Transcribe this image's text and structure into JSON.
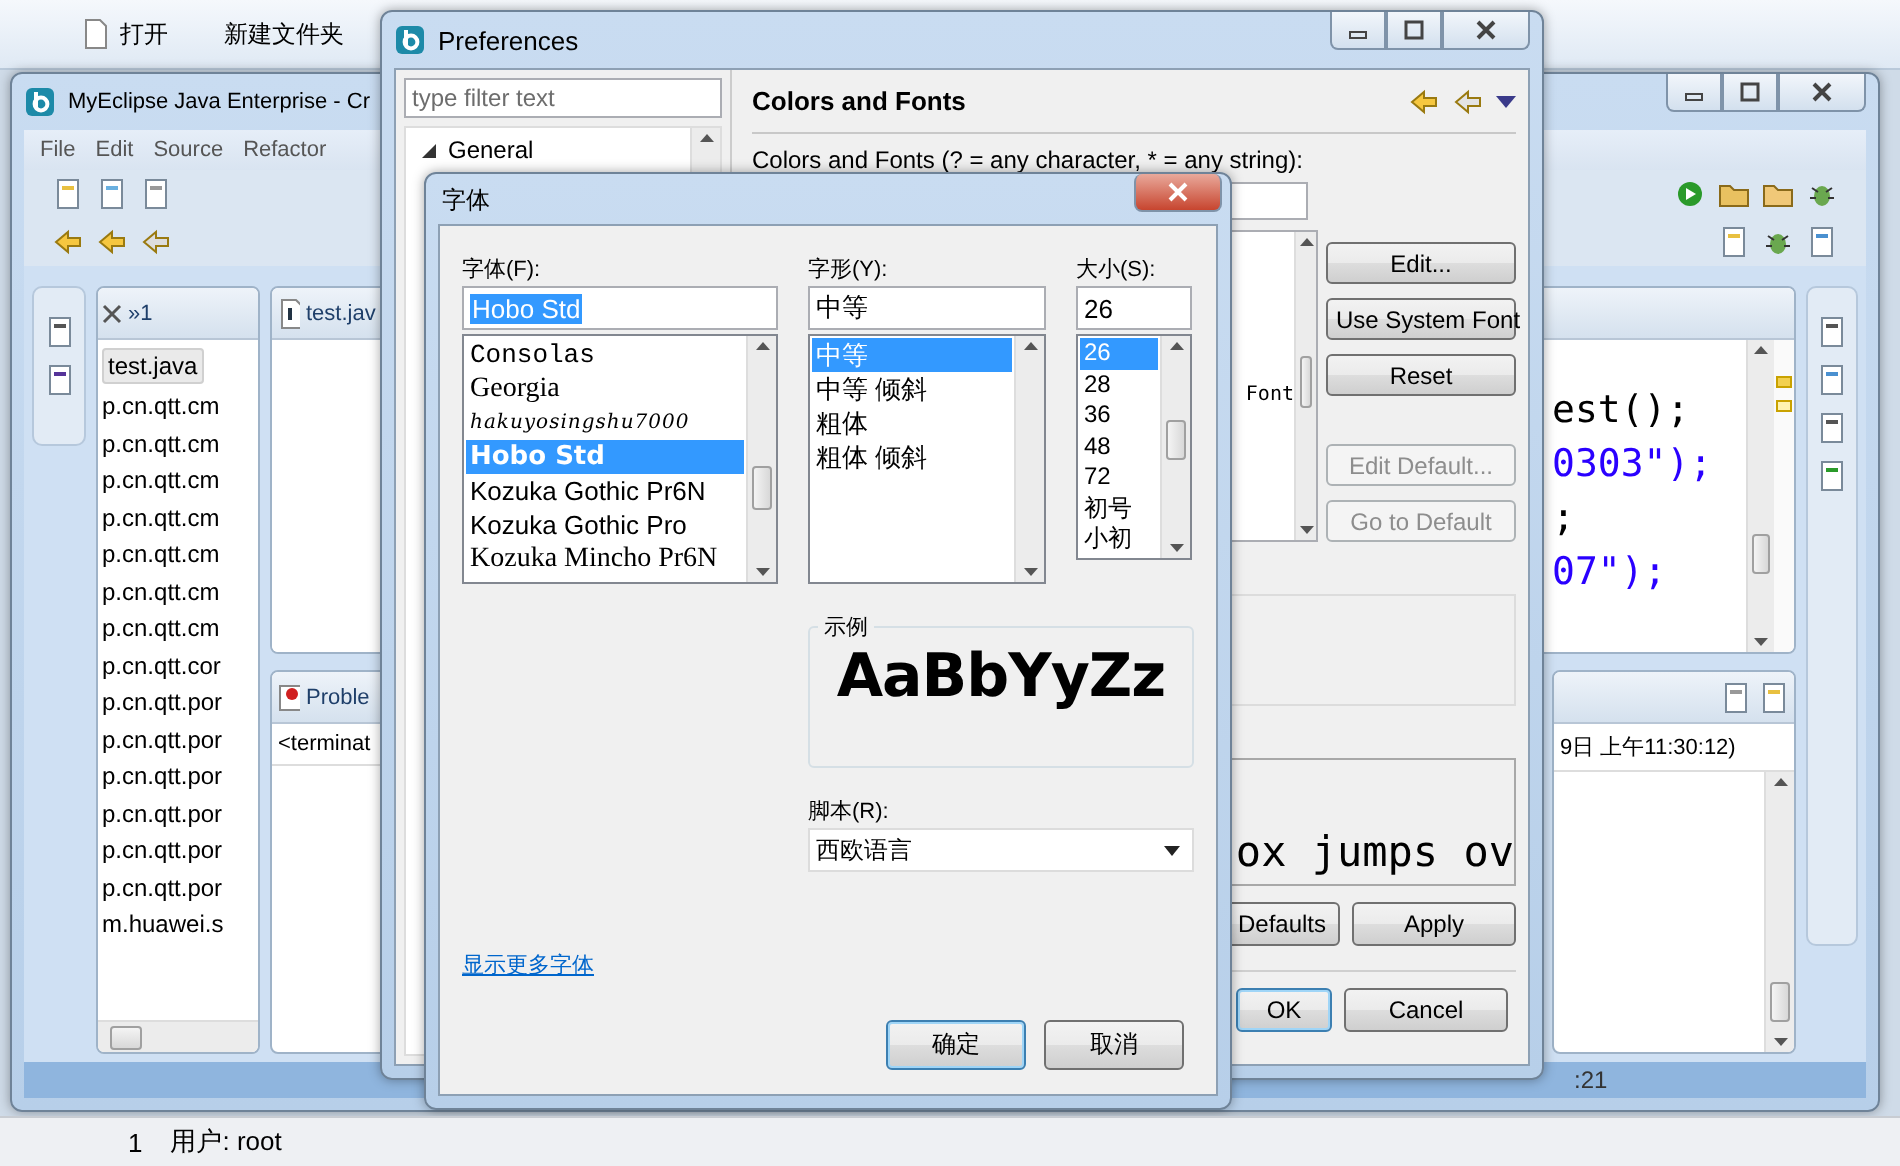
{
  "desktop": {
    "toolbar": [
      "打开",
      "新建文件夹"
    ],
    "status": [
      "1",
      "用户: root"
    ]
  },
  "ide": {
    "title": "MyEclipse Java Enterprise - Cr",
    "menu": [
      "File",
      "Edit",
      "Source",
      "Refactor"
    ],
    "explorer": {
      "tab": "»1",
      "file_tab": "test.java",
      "items": [
        "p.cn.qtt.cm",
        "p.cn.qtt.cm",
        "p.cn.qtt.cm",
        "p.cn.qtt.cm",
        "p.cn.qtt.cm",
        "p.cn.qtt.cm",
        "p.cn.qtt.cm",
        "p.cn.qtt.cor",
        "p.cn.qtt.por",
        "p.cn.qtt.por",
        "p.cn.qtt.por",
        "p.cn.qtt.por",
        "p.cn.qtt.por",
        "p.cn.qtt.por",
        "m.huawei.s"
      ]
    },
    "editor": {
      "tab": "test.jav",
      "code": [
        {
          "text": "est();",
          "kind": "plain"
        },
        {
          "text": "0303\");",
          "kind": "string"
        },
        {
          "text": ";",
          "kind": "plain"
        },
        {
          "text": "07\");",
          "kind": "string"
        }
      ]
    },
    "problems": {
      "tab": "Proble",
      "text": "<terminat"
    },
    "console": {
      "text": "9日 上午11:30:12)"
    },
    "status": ":21"
  },
  "preferences": {
    "title": "Preferences",
    "filter_placeholder": "type filter text",
    "tree": [
      {
        "label": "General",
        "expanded": true
      }
    ],
    "page_title": "Colors and Fonts",
    "description": "Colors and Fonts (? = any character, * = any string):",
    "list_text": "Font",
    "side_buttons": [
      {
        "label": "Edit...",
        "disabled": false
      },
      {
        "label": "Use System Font",
        "disabled": false
      },
      {
        "label": "Reset",
        "disabled": false
      },
      {
        "label": "Edit Default...",
        "disabled": true
      },
      {
        "label": "Go to Default",
        "disabled": true
      }
    ],
    "preview": "ox jumps ov",
    "page_buttons": [
      "Defaults",
      "Apply"
    ],
    "dialog_buttons": [
      {
        "label": "OK",
        "default": true
      },
      {
        "label": "Cancel",
        "default": false
      }
    ]
  },
  "font_dialog": {
    "title": "字体",
    "font": {
      "label": "字体(F):",
      "value": "Hobo Std",
      "value_highlighted": true,
      "items": [
        {
          "label": "Consolas",
          "selected": false,
          "kind": "mono"
        },
        {
          "label": "Georgia",
          "selected": false,
          "kind": "serif"
        },
        {
          "label": "hakuyosingshu7000",
          "selected": false,
          "kind": "script"
        },
        {
          "label": "Hobo Std",
          "selected": true,
          "kind": "bold"
        },
        {
          "label": "Kozuka Gothic Pr6N",
          "selected": false,
          "kind": "sans"
        },
        {
          "label": "Kozuka Gothic Pro",
          "selected": false,
          "kind": "sans"
        },
        {
          "label": "Kozuka Mincho Pr6N",
          "selected": false,
          "kind": "serif"
        }
      ]
    },
    "style": {
      "label": "字形(Y):",
      "value": "中等",
      "items": [
        {
          "label": "中等",
          "selected": true
        },
        {
          "label": "中等 倾斜",
          "selected": false
        },
        {
          "label": "粗体",
          "selected": false
        },
        {
          "label": "粗体 倾斜",
          "selected": false
        }
      ]
    },
    "size": {
      "label": "大小(S):",
      "value": "26",
      "items": [
        {
          "label": "26",
          "selected": true
        },
        {
          "label": "28",
          "selected": false
        },
        {
          "label": "36",
          "selected": false
        },
        {
          "label": "48",
          "selected": false
        },
        {
          "label": "72",
          "selected": false
        },
        {
          "label": "初号",
          "selected": false
        },
        {
          "label": "小初",
          "selected": false
        }
      ]
    },
    "sample": {
      "label": "示例",
      "text": "AaBbYyZz"
    },
    "script": {
      "label": "脚本(R):",
      "value": "西欧语言"
    },
    "link": "显示更多字体",
    "buttons": [
      {
        "label": "确定",
        "default": true
      },
      {
        "label": "取消",
        "default": false
      }
    ]
  }
}
